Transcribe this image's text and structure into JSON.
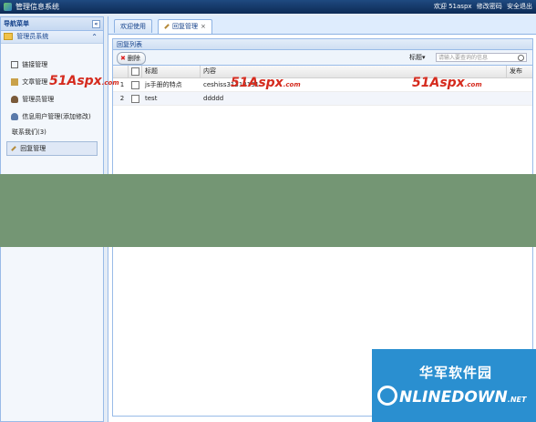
{
  "header": {
    "title": "管理信息系统",
    "welcome": "欢迎 51aspx",
    "change_password": "修改密码",
    "security_exit": "安全退出"
  },
  "sidebar": {
    "title": "导航菜单",
    "collapse_icon": "«",
    "group": "管理员系统",
    "items": [
      {
        "label": "链接管理",
        "icon": "link-icon"
      },
      {
        "label": "文章管理",
        "icon": "add-icon"
      },
      {
        "label": "管理员管理",
        "icon": "user-icon"
      },
      {
        "label": "信息用户管理(添加修改)",
        "icon": "users-icon"
      },
      {
        "label": "联系我们(3)",
        "icon": ""
      },
      {
        "label": "回复管理",
        "icon": "pencil-icon"
      }
    ]
  },
  "tabs": [
    {
      "label": "欢迎使用",
      "active": false
    },
    {
      "label": "回复管理",
      "active": true,
      "close": "×"
    }
  ],
  "panel": {
    "title": "回复列表",
    "delete_label": "删除",
    "search_type": "标题",
    "search_placeholder": "请输入要查询的信息"
  },
  "grid": {
    "columns": [
      "",
      "",
      "标题",
      "内容",
      "发布"
    ],
    "rows": [
      {
        "num": "1",
        "title": "js手册的特点",
        "content": "ceshiss31313131"
      },
      {
        "num": "2",
        "title": "test",
        "content": "ddddd"
      }
    ]
  },
  "watermarks": [
    {
      "text": "51Aspx",
      "suffix": ".com"
    },
    {
      "text": "51Aspx",
      "suffix": ".com"
    },
    {
      "text": "51Aspx",
      "suffix": ".com"
    }
  ],
  "ad": {
    "cn": "华军软件园",
    "en": "NLINEDOWN",
    "tld": ".NET"
  },
  "colors": {
    "accent": "#15428b",
    "band": "#749674",
    "ad_bg": "#2a8fd0",
    "watermark": "#d52b1e"
  }
}
